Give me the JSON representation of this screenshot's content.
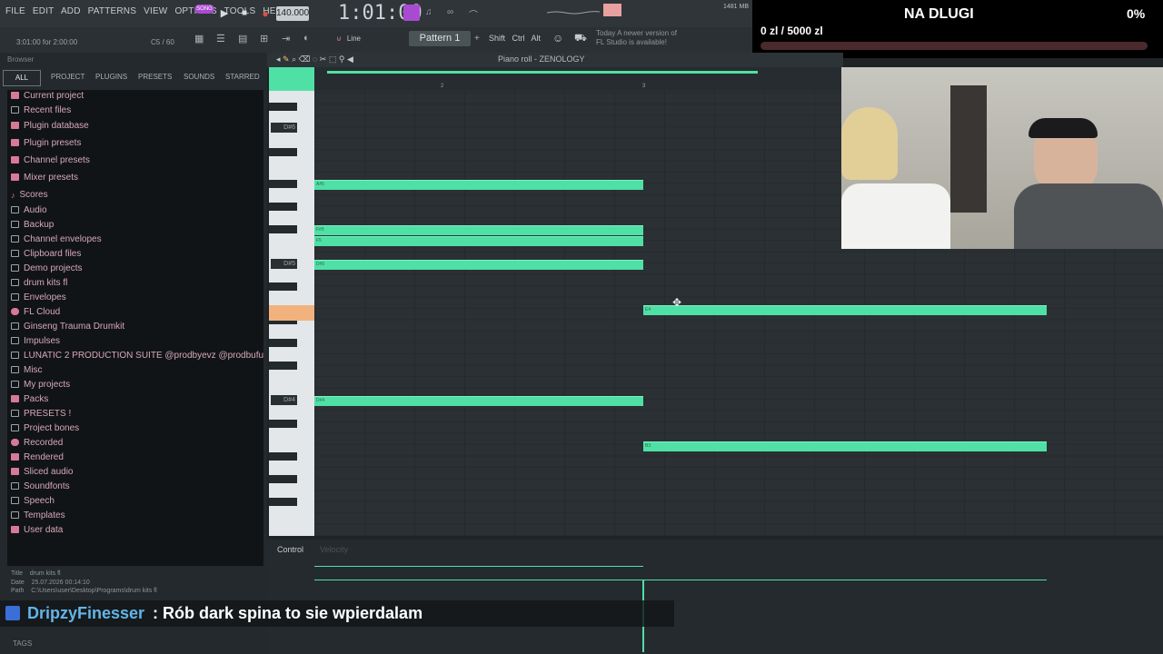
{
  "menu": [
    "FILE",
    "EDIT",
    "ADD",
    "PATTERNS",
    "VIEW",
    "OPTIONS",
    "TOOLS",
    "HELP"
  ],
  "transport": {
    "bpm": "140.000",
    "time": "1:01:00",
    "mode_badge": "SONG"
  },
  "hint": "3:01:00 for 2:00:00",
  "cpu": "C5 / 60",
  "pattern": "Pattern 1",
  "snap": "Line",
  "mods": [
    "Shift",
    "Ctrl",
    "Alt"
  ],
  "news": "Today   A newer version of FL Studio is available!",
  "memory": "1481 MB",
  "overlay": {
    "title": "NA DLUGI",
    "percent": "0%",
    "amount": "0 zl / 5000 zl"
  },
  "browser": {
    "title": "Browser",
    "tabs": [
      "ALL",
      "PROJECT",
      "PLUGINS",
      "PRESETS",
      "SOUNDS",
      "STARRED"
    ],
    "items": [
      "Current project",
      "Recent files",
      "Plugin database",
      "Plugin presets",
      "Channel presets",
      "Mixer presets",
      "Scores",
      "Audio",
      "Backup",
      "Channel envelopes",
      "Clipboard files",
      "Demo projects",
      "drum kits fl",
      "Envelopes",
      "FL Cloud",
      "Ginseng Trauma Drumkit",
      "Impulses",
      "LUNATIC 2 PRODUCTION SUITE @prodbyevz @prodbufu",
      "Misc",
      "My projects",
      "Packs",
      "PRESETS !",
      "Project bones",
      "Recorded",
      "Rendered",
      "Sliced audio",
      "Soundfonts",
      "Speech",
      "Templates",
      "User data"
    ],
    "info": {
      "title_label": "Title",
      "title": "drum kits fl",
      "date_label": "Date",
      "date": "25.07.2026 00:14:10",
      "path_label": "Path",
      "path": "C:\\Users\\user\\Desktop\\Programs\\drum kits fl"
    },
    "tags": "TAGS"
  },
  "pianoroll": {
    "title": "Piano roll - ZENOLOGY",
    "ruler": [
      "2",
      "3"
    ],
    "key_labels": [
      "D#6",
      "D#5",
      "D#4"
    ],
    "notes": [
      "A#5",
      "F#5",
      "F5",
      "D#5",
      "E4",
      "D#4",
      "B3"
    ],
    "control_label": "Control",
    "control_sub": "Velocity"
  },
  "chat": {
    "user": "DripzyFinesser",
    "message": ": Rób dark spina to sie wpierdalam"
  }
}
